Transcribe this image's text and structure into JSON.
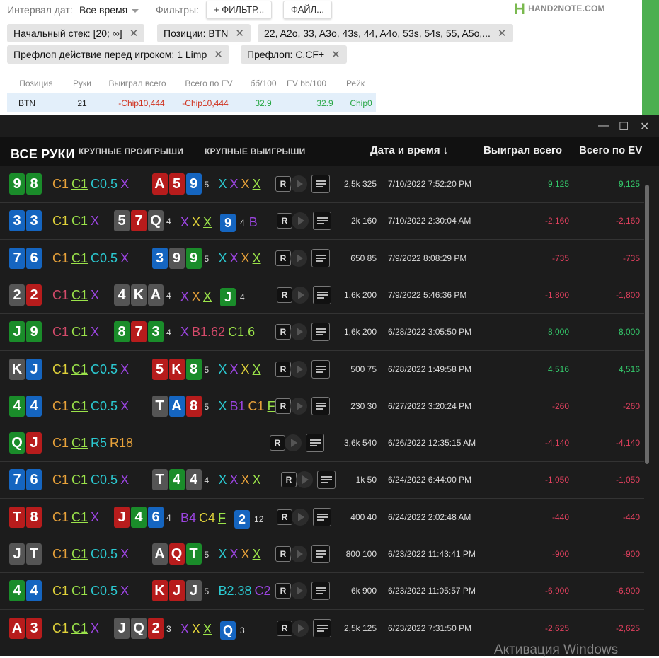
{
  "toolbar": {
    "date_label": "Интервал дат:",
    "date_value": "Все время",
    "filters_label": "Фильтры:",
    "filter_btn": "+ ФИЛЬТР...",
    "file_btn": "ФАЙЛ...",
    "logo": "HAND2NOTE.COM"
  },
  "chips": [
    "Начальный стек: [20; ∞]",
    "Позиции: BTN",
    "22, A2o, 33, A3o, 43s, 44, A4o, 53s, 54s, 55, A5o,...",
    "Префлоп действие перед игроком: 1 Limp",
    "Префлоп: C,CF+"
  ],
  "chip_close": "✕",
  "summary": {
    "headers": [
      "Позиция",
      "Руки",
      "Выиграл всего",
      "Всего по EV",
      "бб/100",
      "EV bb/100",
      "Рейк"
    ],
    "row": [
      "BTN",
      "21",
      "-Chip10,444",
      "-Chip10,444",
      "32.9",
      "32.9",
      "Chip0"
    ]
  },
  "window": {
    "minimize": "—",
    "maximize": "☐",
    "close": "✕"
  },
  "tabs": [
    "ВСЕ РУКИ",
    "КРУПНЫЕ ПРОИГРЫШИ",
    "КРУПНЫЕ ВЫИГРЫШИ"
  ],
  "columns": {
    "date": "Дата и время ↓",
    "won": "Выиграл всего",
    "ev": "Всего по EV"
  },
  "colors": {
    "club": "#1a8c2a",
    "diamond": "#1565c0",
    "heart": "#b71c1c",
    "spade": "#555555",
    "win": "#34c76a",
    "loss": "#e0405e"
  },
  "hands": [
    {
      "hole": [
        [
          "9",
          "c"
        ],
        [
          "8",
          "c"
        ]
      ],
      "pre": [
        [
          "C1",
          "#e8a23a"
        ],
        [
          "C1",
          "#9be34a",
          1
        ],
        [
          "C0.5",
          "#2bc9d1"
        ],
        [
          "X",
          "#9b44e0"
        ]
      ],
      "flop": [
        [
          "A",
          "h"
        ],
        [
          "5",
          "h"
        ],
        [
          "9",
          "d"
        ]
      ],
      "fn": "5",
      "post": [
        [
          "X",
          "#2bc9d1"
        ],
        [
          "X",
          "#9b44e0"
        ],
        [
          "X",
          "#e8a23a"
        ],
        [
          "X",
          "#9be34a",
          1
        ]
      ],
      "stakes": "2,5k 325",
      "date": "7/10/2022 7:52:20 PM",
      "won": "9,125",
      "ev": "9,125"
    },
    {
      "hole": [
        [
          "3",
          "d"
        ],
        [
          "3",
          "d"
        ]
      ],
      "pre": [
        [
          "C1",
          "#e0d23a"
        ],
        [
          "C1",
          "#9be34a",
          1
        ],
        [
          "X",
          "#9b44e0"
        ]
      ],
      "flop": [
        [
          "5",
          "s"
        ],
        [
          "7",
          "h"
        ],
        [
          "Q",
          "s"
        ]
      ],
      "fn": "4",
      "post": [
        [
          "X",
          "#9b44e0"
        ],
        [
          "X",
          "#e0d23a"
        ],
        [
          "X",
          "#9be34a",
          1
        ],
        [
          "9",
          "d",
          2
        ],
        [
          "4",
          "#ddd",
          3
        ],
        [
          "B",
          "#9b44e0"
        ]
      ],
      "stakes": "2k 160",
      "date": "7/10/2022 2:30:04 AM",
      "won": "-2,160",
      "ev": "-2,160"
    },
    {
      "hole": [
        [
          "7",
          "d"
        ],
        [
          "6",
          "d"
        ]
      ],
      "pre": [
        [
          "C1",
          "#e8a23a"
        ],
        [
          "C1",
          "#9be34a",
          1
        ],
        [
          "C0.5",
          "#2bc9d1"
        ],
        [
          "X",
          "#9b44e0"
        ]
      ],
      "flop": [
        [
          "3",
          "d"
        ],
        [
          "9",
          "s"
        ],
        [
          "9",
          "c"
        ]
      ],
      "fn": "5",
      "post": [
        [
          "X",
          "#2bc9d1"
        ],
        [
          "X",
          "#9b44e0"
        ],
        [
          "X",
          "#e8a23a"
        ],
        [
          "X",
          "#9be34a",
          1
        ]
      ],
      "stakes": "650 85",
      "date": "7/9/2022 8:08:29 PM",
      "won": "-735",
      "ev": "-735"
    },
    {
      "hole": [
        [
          "2",
          "s"
        ],
        [
          "2",
          "h"
        ]
      ],
      "pre": [
        [
          "C1",
          "#d44a6a"
        ],
        [
          "C1",
          "#9be34a",
          1
        ],
        [
          "X",
          "#9b44e0"
        ]
      ],
      "flop": [
        [
          "4",
          "s"
        ],
        [
          "K",
          "s"
        ],
        [
          "A",
          "s"
        ]
      ],
      "fn": "4",
      "post": [
        [
          "X",
          "#9b44e0"
        ],
        [
          "X",
          "#e8a23a"
        ],
        [
          "X",
          "#9be34a",
          1
        ],
        [
          "J",
          "c",
          2
        ],
        [
          "4",
          "#ddd",
          3
        ]
      ],
      "stakes": "1,6k 200",
      "date": "7/9/2022 5:46:36 PM",
      "won": "-1,800",
      "ev": "-1,800"
    },
    {
      "hole": [
        [
          "J",
          "c"
        ],
        [
          "9",
          "c"
        ]
      ],
      "pre": [
        [
          "C1",
          "#d44a6a"
        ],
        [
          "C1",
          "#9be34a",
          1
        ],
        [
          "X",
          "#9b44e0"
        ]
      ],
      "flop": [
        [
          "8",
          "c"
        ],
        [
          "7",
          "h"
        ],
        [
          "3",
          "c"
        ]
      ],
      "fn": "4",
      "post": [
        [
          "X",
          "#9b44e0"
        ],
        [
          "B1.62",
          "#d44a6a"
        ],
        [
          "C1.6",
          "#9be34a",
          1
        ]
      ],
      "stakes": "1,6k 200",
      "date": "6/28/2022 3:05:50 PM",
      "won": "8,000",
      "ev": "8,000"
    },
    {
      "hole": [
        [
          "K",
          "s"
        ],
        [
          "J",
          "d"
        ]
      ],
      "pre": [
        [
          "C1",
          "#e0d23a"
        ],
        [
          "C1",
          "#9be34a",
          1
        ],
        [
          "C0.5",
          "#2bc9d1"
        ],
        [
          "X",
          "#9b44e0"
        ]
      ],
      "flop": [
        [
          "5",
          "h"
        ],
        [
          "K",
          "h"
        ],
        [
          "8",
          "c"
        ]
      ],
      "fn": "5",
      "post": [
        [
          "X",
          "#2bc9d1"
        ],
        [
          "X",
          "#9b44e0"
        ],
        [
          "X",
          "#e0d23a"
        ],
        [
          "X",
          "#9be34a",
          1
        ]
      ],
      "stakes": "500 75",
      "date": "6/28/2022 1:49:58 PM",
      "won": "4,516",
      "ev": "4,516"
    },
    {
      "hole": [
        [
          "4",
          "c"
        ],
        [
          "4",
          "d"
        ]
      ],
      "pre": [
        [
          "C1",
          "#e8a23a"
        ],
        [
          "C1",
          "#9be34a",
          1
        ],
        [
          "C0.5",
          "#2bc9d1"
        ],
        [
          "X",
          "#9b44e0"
        ]
      ],
      "flop": [
        [
          "T",
          "s"
        ],
        [
          "A",
          "d"
        ],
        [
          "8",
          "h"
        ]
      ],
      "fn": "5",
      "post": [
        [
          "X",
          "#2bc9d1"
        ],
        [
          "B1",
          "#9b44e0"
        ],
        [
          "C1",
          "#e8a23a"
        ],
        [
          "F",
          "#9be34a",
          1
        ]
      ],
      "stakes": "230 30",
      "date": "6/27/2022 3:20:24 PM",
      "won": "-260",
      "ev": "-260"
    },
    {
      "hole": [
        [
          "Q",
          "c"
        ],
        [
          "J",
          "h"
        ]
      ],
      "pre": [
        [
          "C1",
          "#e8a23a"
        ],
        [
          "C1",
          "#9be34a",
          1
        ],
        [
          "R5",
          "#2bc9d1"
        ],
        [
          "R18",
          "#e8a23a"
        ]
      ],
      "flop": [],
      "fn": "",
      "post": [],
      "stakes": "3,6k 540",
      "date": "6/26/2022 12:35:15 AM",
      "won": "-4,140",
      "ev": "-4,140"
    },
    {
      "hole": [
        [
          "7",
          "d"
        ],
        [
          "6",
          "d"
        ]
      ],
      "pre": [
        [
          "C1",
          "#e8a23a"
        ],
        [
          "C1",
          "#9be34a",
          1
        ],
        [
          "C0.5",
          "#2bc9d1"
        ],
        [
          "X",
          "#9b44e0"
        ]
      ],
      "flop": [
        [
          "T",
          "s"
        ],
        [
          "4",
          "c"
        ],
        [
          "4",
          "s"
        ]
      ],
      "fn": "4",
      "post": [
        [
          "X",
          "#2bc9d1"
        ],
        [
          "X",
          "#9b44e0"
        ],
        [
          "X",
          "#e8a23a"
        ],
        [
          "X",
          "#9be34a",
          1
        ]
      ],
      "stakes": "1k 50",
      "date": "6/24/2022 6:44:00 PM",
      "won": "-1,050",
      "ev": "-1,050"
    },
    {
      "hole": [
        [
          "T",
          "h"
        ],
        [
          "8",
          "h"
        ]
      ],
      "pre": [
        [
          "C1",
          "#e8a23a"
        ],
        [
          "C1",
          "#9be34a",
          1
        ],
        [
          "X",
          "#9b44e0"
        ]
      ],
      "flop": [
        [
          "J",
          "h"
        ],
        [
          "4",
          "c"
        ],
        [
          "6",
          "d"
        ]
      ],
      "fn": "4",
      "post": [
        [
          "B4",
          "#9b44e0"
        ],
        [
          "C4",
          "#e0d23a"
        ],
        [
          "F",
          "#9be34a",
          1
        ],
        [
          "2",
          "d",
          2
        ],
        [
          "12",
          "#ddd",
          3
        ]
      ],
      "stakes": "400 40",
      "date": "6/24/2022 2:02:48 AM",
      "won": "-440",
      "ev": "-440"
    },
    {
      "hole": [
        [
          "J",
          "s"
        ],
        [
          "T",
          "s"
        ]
      ],
      "pre": [
        [
          "C1",
          "#e8a23a"
        ],
        [
          "C1",
          "#9be34a",
          1
        ],
        [
          "C0.5",
          "#2bc9d1"
        ],
        [
          "X",
          "#9b44e0"
        ]
      ],
      "flop": [
        [
          "A",
          "s"
        ],
        [
          "Q",
          "h"
        ],
        [
          "T",
          "c"
        ]
      ],
      "fn": "5",
      "post": [
        [
          "X",
          "#2bc9d1"
        ],
        [
          "X",
          "#9b44e0"
        ],
        [
          "X",
          "#e8a23a"
        ],
        [
          "X",
          "#9be34a",
          1
        ]
      ],
      "stakes": "800 100",
      "date": "6/23/2022 11:43:41 PM",
      "won": "-900",
      "ev": "-900"
    },
    {
      "hole": [
        [
          "4",
          "c"
        ],
        [
          "4",
          "d"
        ]
      ],
      "pre": [
        [
          "C1",
          "#e0d23a"
        ],
        [
          "C1",
          "#9be34a",
          1
        ],
        [
          "C0.5",
          "#2bc9d1"
        ],
        [
          "X",
          "#9b44e0"
        ]
      ],
      "flop": [
        [
          "K",
          "h"
        ],
        [
          "J",
          "h"
        ],
        [
          "J",
          "s"
        ]
      ],
      "fn": "5",
      "post": [
        [
          "B2.38",
          "#2bc9d1"
        ],
        [
          "C2",
          "#9b44e0"
        ]
      ],
      "stakes": "6k 900",
      "date": "6/23/2022 11:05:57 PM",
      "won": "-6,900",
      "ev": "-6,900"
    },
    {
      "hole": [
        [
          "A",
          "h"
        ],
        [
          "3",
          "h"
        ]
      ],
      "pre": [
        [
          "C1",
          "#e0d23a"
        ],
        [
          "C1",
          "#9be34a",
          1
        ],
        [
          "X",
          "#9b44e0"
        ]
      ],
      "flop": [
        [
          "J",
          "s"
        ],
        [
          "Q",
          "s"
        ],
        [
          "2",
          "h"
        ]
      ],
      "fn": "3",
      "post": [
        [
          "X",
          "#9b44e0"
        ],
        [
          "X",
          "#e0d23a"
        ],
        [
          "X",
          "#9be34a",
          1
        ],
        [
          "Q",
          "d",
          2
        ],
        [
          "3",
          "#ddd",
          3
        ]
      ],
      "stakes": "2,5k 125",
      "date": "6/23/2022 7:31:50 PM",
      "won": "-2,625",
      "ev": "-2,625"
    }
  ],
  "icons": {
    "replay": "R",
    "play": "play-icon",
    "details": "list-icon"
  },
  "watermark": "Активация Windows"
}
